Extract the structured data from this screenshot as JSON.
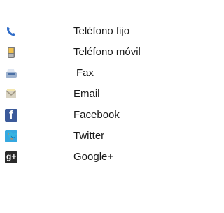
{
  "contacts": [
    {
      "icon": "landline-phone-icon",
      "label": "Teléfono fijo"
    },
    {
      "icon": "mobile-phone-icon",
      "label": "Teléfono móvil"
    },
    {
      "icon": "fax-icon",
      "label": "Fax"
    },
    {
      "icon": "email-icon",
      "label": "Email"
    },
    {
      "icon": "facebook-icon",
      "label": "Facebook"
    },
    {
      "icon": "twitter-icon",
      "label": "Twitter"
    },
    {
      "icon": "google-plus-icon",
      "label": "Google+"
    }
  ]
}
